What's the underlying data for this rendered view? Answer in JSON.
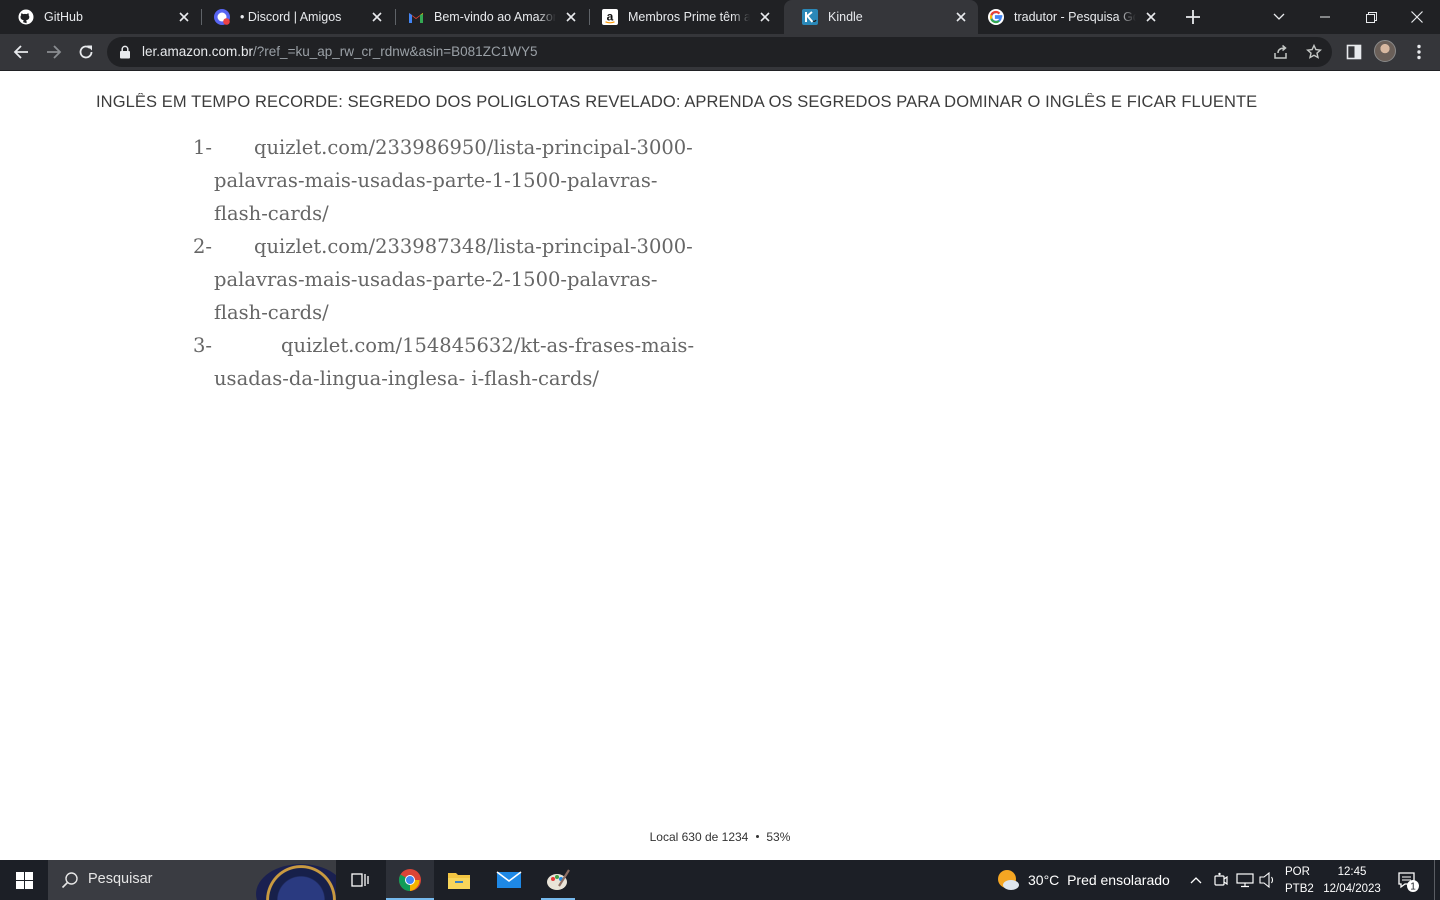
{
  "browser": {
    "tabs": [
      {
        "title": "GitHub",
        "icon": "github-icon",
        "active": false
      },
      {
        "title": "• Discord | Amigos",
        "icon": "discord-icon",
        "active": false
      },
      {
        "title": "Bem-vindo ao Amazon P",
        "icon": "gmail-icon",
        "active": false
      },
      {
        "title": "Membros Prime têm ace",
        "icon": "amazon-icon",
        "active": false
      },
      {
        "title": "Kindle",
        "icon": "kindle-icon",
        "active": true
      },
      {
        "title": "tradutor - Pesquisa Goog",
        "icon": "google-icon",
        "active": false
      }
    ],
    "url_host": "ler.amazon.com.br",
    "url_path": "/?ref_=ku_ap_rw_cr_rdnw&asin=B081ZC1WY5"
  },
  "reader": {
    "book_title": "INGLÊS EM TEMPO RECORDE: SEGREDO DOS POLIGLOTAS REVELADO: APRENDA OS SEGREDOS PARA DOMINAR O INGLÊS E FICAR FLUENTE",
    "items": [
      {
        "num": "1-",
        "text": "quizlet.com/233986950/lista-principal-3000-palavras-mais-usadas-parte-1-1500-palavras-flash-cards/"
      },
      {
        "num": "2-",
        "text": "quizlet.com/233987348/lista-principal-3000-palavras-mais-usadas-parte-2-1500-palavras-flash-cards/"
      },
      {
        "num": "3-",
        "text": "quizlet.com/154845632/kt-as-frases-mais-usadas-da-lingua-inglesa-  i-flash-cards/"
      }
    ],
    "location": "Local 630 de 1234",
    "percent": "53%"
  },
  "taskbar": {
    "search_placeholder": "Pesquisar",
    "temperature": "30°C",
    "weather": "Pred ensolarado",
    "lang_top": "POR",
    "lang_bottom": "PTB2",
    "time": "12:45",
    "date": "12/04/2023",
    "notification_count": "1"
  },
  "colors": {
    "tabstrip": "#202124",
    "toolbar": "#35363a",
    "text_gray": "#666666",
    "taskbar": "#1c1f26",
    "accent": "#76b9ed"
  }
}
